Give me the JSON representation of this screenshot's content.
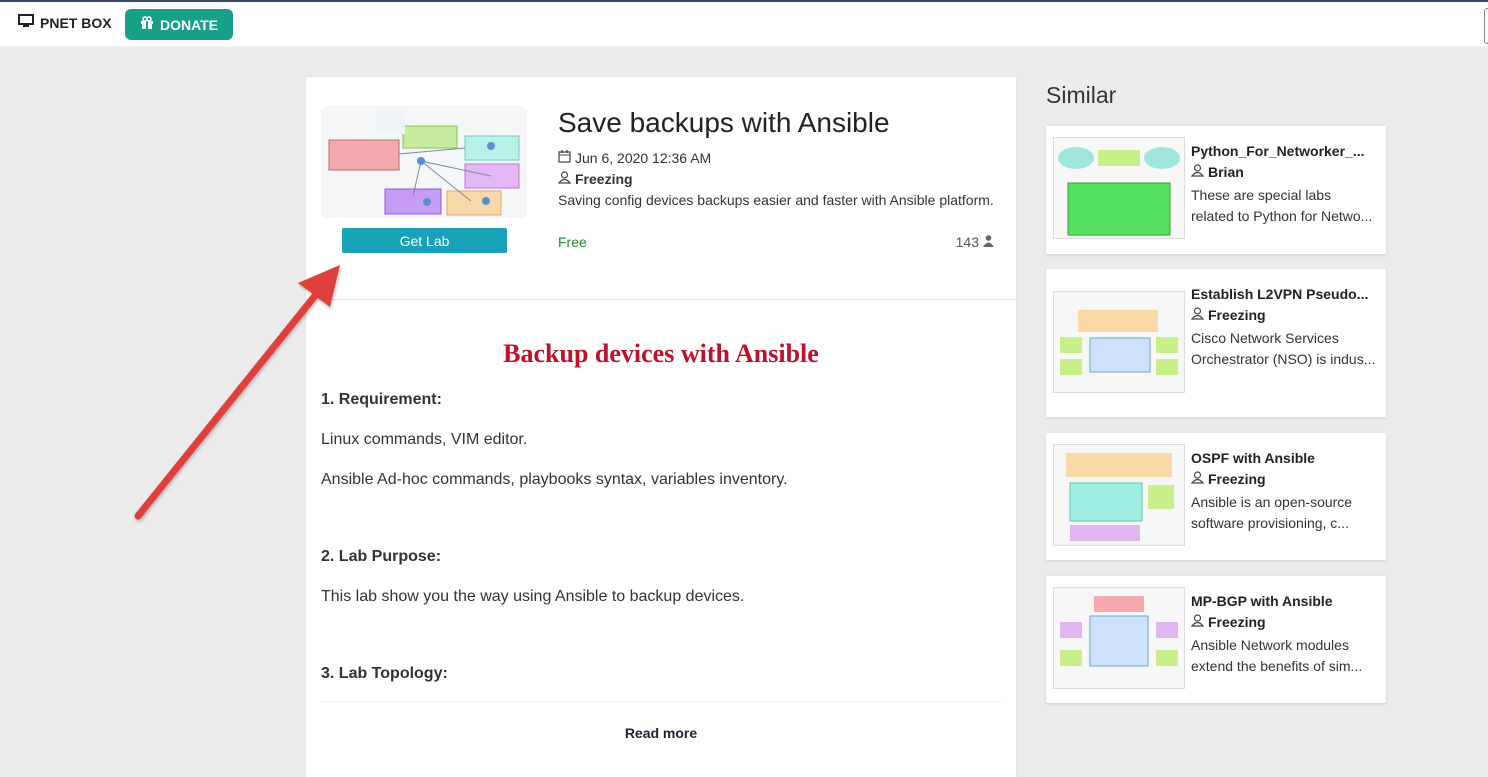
{
  "topbar": {
    "brand_label": "PNET BOX",
    "donate_label": "DONATE",
    "colors": {
      "donate_bg": "#17a08a"
    }
  },
  "lab": {
    "title": "Save backups with Ansible",
    "date": "Jun 6, 2020 12:36 AM",
    "author": "Freezing",
    "description": "Saving config devices backups easier and faster with Ansible platform.",
    "price": "Free",
    "views": "143",
    "get_lab_label": "Get Lab",
    "colors": {
      "get_lab_bg": "#17a2b8",
      "price": "#1e8a2c"
    }
  },
  "content": {
    "heading": "Backup devices with Ansible",
    "heading_color": "#c0102a",
    "sections": [
      {
        "title": "1. Requirement:",
        "lines": [
          "Linux commands, VIM editor.",
          "Ansible Ad-hoc commands, playbooks syntax, variables inventory."
        ]
      },
      {
        "title": "2. Lab Purpose:",
        "lines": [
          "This lab show you the way using Ansible to backup devices."
        ]
      },
      {
        "title": "3. Lab Topology:",
        "lines": []
      }
    ],
    "read_more_label": "Read more"
  },
  "similar": {
    "heading": "Similar",
    "items": [
      {
        "title": "Python_For_Networker_...",
        "author": "Brian",
        "description": "These are special labs related to Python for Netwo..."
      },
      {
        "title": "Establish L2VPN Pseudo...",
        "author": "Freezing",
        "description": "Cisco Network Services Orchestrator (NSO) is indus..."
      },
      {
        "title": "OSPF with Ansible",
        "author": "Freezing",
        "description": "Ansible is an open-source software provisioning, c..."
      },
      {
        "title": "MP-BGP with Ansible",
        "author": "Freezing",
        "description": "Ansible Network modules extend the benefits of sim..."
      }
    ]
  },
  "annotation": {
    "arrow_color": "#e0403a"
  },
  "icons": [
    "monitor-icon",
    "gift-icon",
    "calendar-icon",
    "user-icon",
    "users-icon"
  ]
}
